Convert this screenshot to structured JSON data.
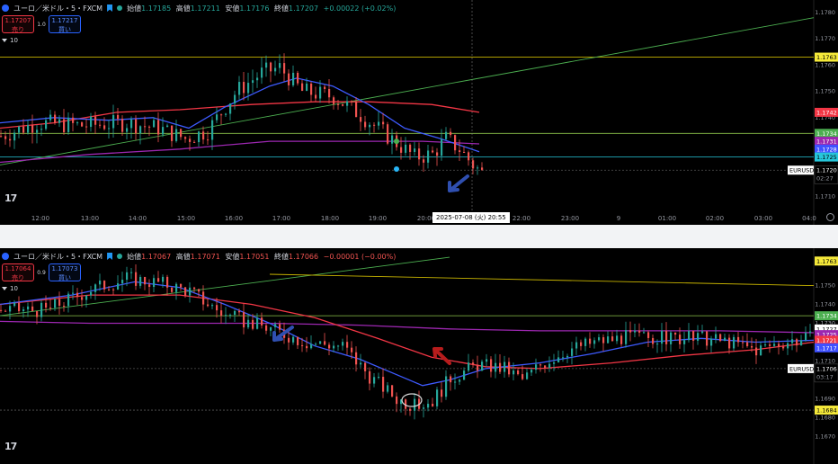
{
  "panels": [
    {
      "symbol": "ユーロ／米ドル・5・FXCM",
      "ohlc": [
        {
          "label": "始値",
          "value": "1.17185"
        },
        {
          "label": "高値",
          "value": "1.17211"
        },
        {
          "label": "安値",
          "value": "1.17176"
        },
        {
          "label": "終値",
          "value": "1.17207"
        }
      ],
      "change": "+0.00022 (+0.02%)",
      "change_dir": "up",
      "sell": {
        "price": "1.17207",
        "label": "売り"
      },
      "spread": "1.0",
      "buy": {
        "price": "1.17217",
        "label": "買い"
      },
      "indicators_count": "10",
      "price_axis": [
        "1.1780",
        "1.1770",
        "1.1760",
        "1.1750",
        "1.1740",
        "1.1730",
        "1.1720",
        "1.1710"
      ],
      "price_range": [
        1.1704,
        1.1782
      ],
      "price_tags": [
        {
          "value": "1.1763",
          "price": 1.1763,
          "bg": "#f5e93a",
          "fg": "#000000"
        },
        {
          "value": "1.1742",
          "price": 1.1742,
          "bg": "#f23645",
          "fg": "#ffffff"
        },
        {
          "value": "1.1734",
          "price": 1.1734,
          "bg": "#4caf50",
          "fg": "#ffffff"
        },
        {
          "value": "1.1731",
          "price": 1.1731,
          "bg": "#9c27b0",
          "fg": "#ffffff"
        },
        {
          "value": "1.1728",
          "price": 1.1728,
          "bg": "#3f51ff",
          "fg": "#ffffff"
        },
        {
          "value": "1.1725",
          "price": 1.1725,
          "bg": "#26c6da",
          "fg": "#000000"
        }
      ],
      "current": {
        "symbol": "EURUSD",
        "price": "1.1720",
        "price_value": 1.172,
        "countdown": "02:27"
      },
      "time_axis": [
        "12:00",
        "13:00",
        "14:00",
        "15:00",
        "16:00",
        "17:00",
        "18:00",
        "19:00",
        "20:00",
        "22:00",
        "23:00",
        "9",
        "01:00",
        "02:00",
        "03:00",
        "04:0"
      ],
      "crosshair_label": "2025-07-08 (火)   20:55",
      "hlines": [
        {
          "price": 1.1763,
          "color": "#c8b400"
        },
        {
          "price": 1.1734,
          "color": "#8bc34a"
        },
        {
          "price": 1.1725,
          "color": "#26c6da"
        },
        {
          "price": 1.172,
          "color": "#555555",
          "dash": true
        }
      ]
    },
    {
      "symbol": "ユーロ／米ドル・5・FXCM",
      "ohlc": [
        {
          "label": "始値",
          "value": "1.17067"
        },
        {
          "label": "高値",
          "value": "1.17071"
        },
        {
          "label": "安値",
          "value": "1.17051"
        },
        {
          "label": "終値",
          "value": "1.17066"
        }
      ],
      "change": "−0.00001 (−0.00%)",
      "change_dir": "down",
      "sell": {
        "price": "1.17064",
        "label": "売り"
      },
      "spread": "0.9",
      "buy": {
        "price": "1.17073",
        "label": "買い"
      },
      "indicators_count": "10",
      "price_axis": [
        "1.1750",
        "1.1740",
        "1.1730",
        "1.1720",
        "1.1710",
        "1.1700",
        "1.1690",
        "1.1680",
        "1.1670"
      ],
      "price_range": [
        1.1664,
        1.1766
      ],
      "price_tags": [
        {
          "value": "1.1763",
          "price": 1.1763,
          "bg": "#f5e93a",
          "fg": "#000000"
        },
        {
          "value": "1.1734",
          "price": 1.1734,
          "bg": "#4caf50",
          "fg": "#ffffff"
        },
        {
          "value": "1.1727",
          "price": 1.1727,
          "bg": "#ffffff",
          "fg": "#000000"
        },
        {
          "value": "1.1725",
          "price": 1.1724,
          "bg": "#9c27b0",
          "fg": "#ffffff"
        },
        {
          "value": "1.1721",
          "price": 1.1721,
          "bg": "#f23645",
          "fg": "#ffffff"
        },
        {
          "value": "1.1717",
          "price": 1.1717,
          "bg": "#3f51ff",
          "fg": "#ffffff"
        },
        {
          "value": "1.1684",
          "price": 1.1684,
          "bg": "#f5e93a",
          "fg": "#000000"
        }
      ],
      "current": {
        "symbol": "EURUSD",
        "price": "1.1706",
        "price_value": 1.1706,
        "countdown": "03:17"
      },
      "hlines": [
        {
          "price": 1.1734,
          "color": "#8bc34a"
        },
        {
          "price": 1.1706,
          "color": "#555555",
          "dash": true
        },
        {
          "price": 1.1684,
          "color": "#555555",
          "dash": true
        }
      ]
    }
  ],
  "logo": "17",
  "colors": {
    "up": "#26a69a",
    "down": "#ef5350",
    "ma_fast": "#3d5afe",
    "ma_mid": "#f23645",
    "ma_slow": "#9c27b0",
    "trend": "#4caf50",
    "yellow": "#c8b400",
    "arrow": "#2f4fb0"
  }
}
